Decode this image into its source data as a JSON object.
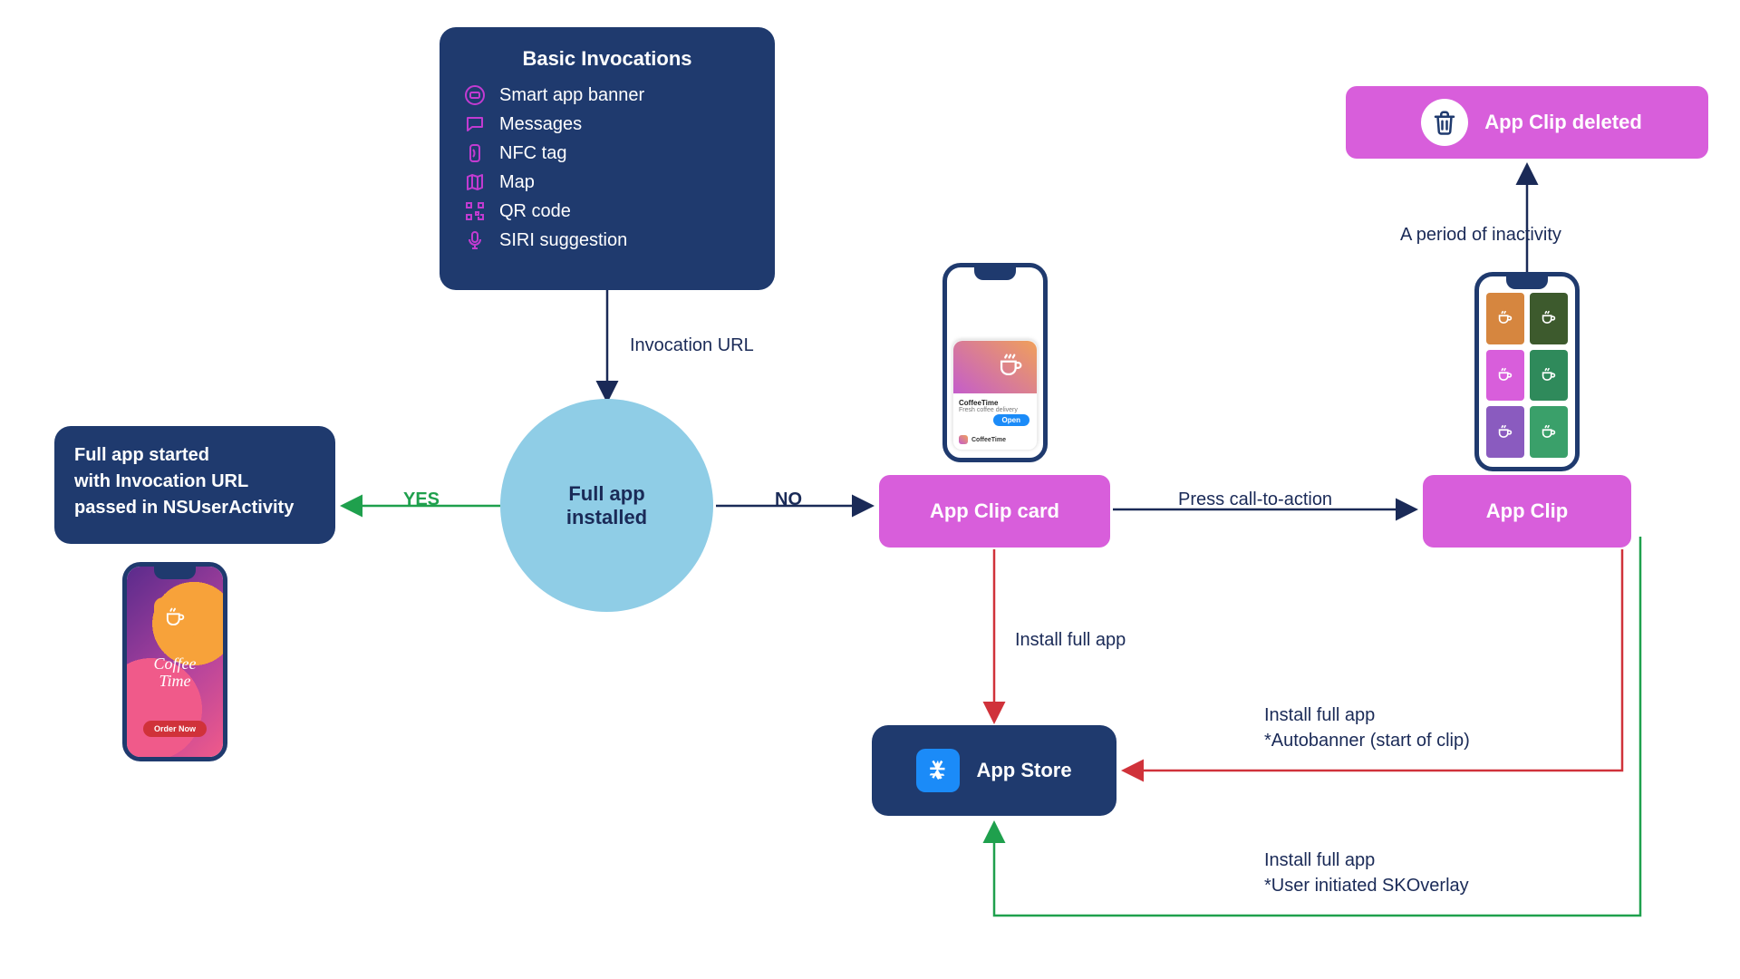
{
  "invocations": {
    "title": "Basic Invocations",
    "items": [
      {
        "label": "Smart app banner",
        "icon": "smart-banner-icon"
      },
      {
        "label": "Messages",
        "icon": "messages-icon"
      },
      {
        "label": "NFC tag",
        "icon": "nfc-icon"
      },
      {
        "label": "Map",
        "icon": "map-icon"
      },
      {
        "label": "QR code",
        "icon": "qr-icon"
      },
      {
        "label": "SIRI suggestion",
        "icon": "siri-icon"
      }
    ]
  },
  "edges": {
    "invocation_url": "Invocation URL",
    "yes": "YES",
    "no": "NO",
    "press_cta": "Press call-to-action",
    "install_full_app": "Install full app",
    "install_autobanner_l1": "Install full app",
    "install_autobanner_l2": "*Autobanner (start of clip)",
    "install_skoverlay_l1": "Install full app",
    "install_skoverlay_l2": "*User initiated SKOverlay",
    "inactivity": "A period of inactivity"
  },
  "nodes": {
    "full_app_started_l1": "Full app started",
    "full_app_started_l2": "with Invocation URL",
    "full_app_started_l3": "passed in NSUserActivity",
    "decision_l1": "Full app",
    "decision_l2": "installed",
    "app_clip_card": "App Clip card",
    "app_clip": "App Clip",
    "app_clip_deleted": "App Clip deleted",
    "app_store": "App Store"
  },
  "mockups": {
    "coffee_brand_l1": "Coffee",
    "coffee_brand_l2": "Time",
    "coffee_cta": "Order Now",
    "card_title": "CoffeeTime",
    "card_sub": "Fresh coffee delivery",
    "card_open": "Open",
    "card_brand": "CoffeeTime",
    "grid_colors": [
      "#d6863f",
      "#3d5a2d",
      "#d85edb",
      "#2f8a5b",
      "#8a5bbf",
      "#3aa06a"
    ]
  },
  "colors": {
    "navy": "#1f3a6e",
    "pink": "#d85edb",
    "lightblue": "#8fcde6",
    "green": "#1fa04d",
    "red": "#d0323a",
    "magenta_stroke": "#c23bd1"
  }
}
